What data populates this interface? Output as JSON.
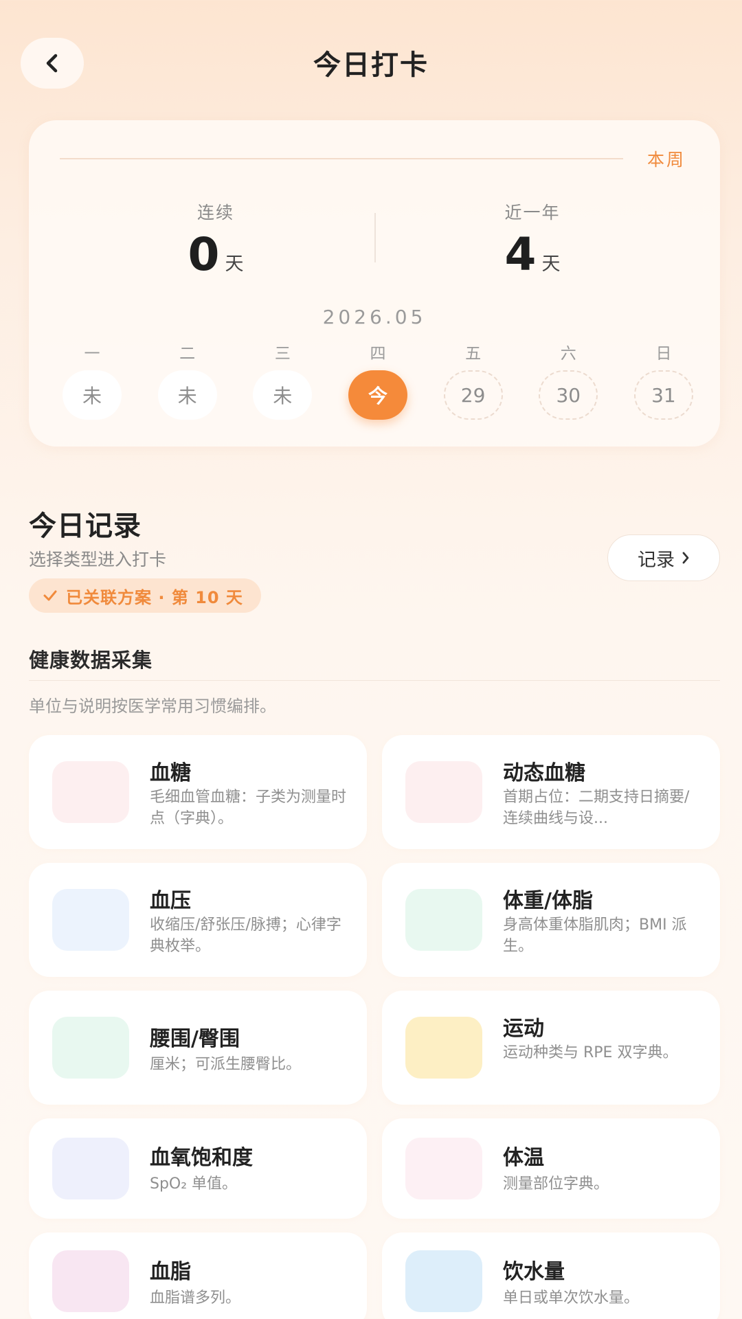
{
  "header": {
    "title": "今日打卡"
  },
  "streak": {
    "week_toggle": "本周",
    "consecutive_label": "连续",
    "consecutive_value": "0",
    "consecutive_unit": "天",
    "year_label": "近一年",
    "year_value": "4",
    "year_unit": "天",
    "month": "2026.05",
    "days": [
      {
        "name": "一",
        "label": "未",
        "state": "past"
      },
      {
        "name": "二",
        "label": "未",
        "state": "past"
      },
      {
        "name": "三",
        "label": "未",
        "state": "past"
      },
      {
        "name": "四",
        "label": "今",
        "state": "today"
      },
      {
        "name": "五",
        "label": "29",
        "state": "future"
      },
      {
        "name": "六",
        "label": "30",
        "state": "future"
      },
      {
        "name": "日",
        "label": "31",
        "state": "future"
      }
    ]
  },
  "records": {
    "title": "今日记录",
    "subtitle": "选择类型进入打卡",
    "plan_badge": "已关联方案 · 第 10 天",
    "record_button": "记录"
  },
  "section": {
    "title": "健康数据采集",
    "note": "单位与说明按医学常用习惯编排。"
  },
  "tiles": [
    {
      "title": "血糖",
      "desc": "毛细血管血糖：子类为测量时点（字典）。",
      "icon_color": "#fdeff0"
    },
    {
      "title": "动态血糖",
      "desc": "首期占位：二期支持日摘要/连续曲线与设...",
      "icon_color": "#fdeff0"
    },
    {
      "title": "血压",
      "desc": "收缩压/舒张压/脉搏；心律字典枚举。",
      "icon_color": "#ecf3fd"
    },
    {
      "title": "体重/体脂",
      "desc": "身高体重体脂肌肉；BMI 派生。",
      "icon_color": "#e8f8f0"
    },
    {
      "title": "腰围/臀围",
      "desc": "厘米；可派生腰臀比。",
      "icon_color": "#e8f8f0"
    },
    {
      "title": "运动",
      "desc": "运动种类与 RPE 双字典。",
      "icon_color": "#fdefc4"
    },
    {
      "title": "血氧饱和度",
      "desc": "SpO₂ 单值。",
      "icon_color": "#eef0fc"
    },
    {
      "title": "体温",
      "desc": "测量部位字典。",
      "icon_color": "#fdf0f4"
    },
    {
      "title": "血脂",
      "desc": "血脂谱多列。",
      "icon_color": "#f8e6f2"
    },
    {
      "title": "饮水量",
      "desc": "单日或单次饮水量。",
      "icon_color": "#ddeefa"
    }
  ]
}
